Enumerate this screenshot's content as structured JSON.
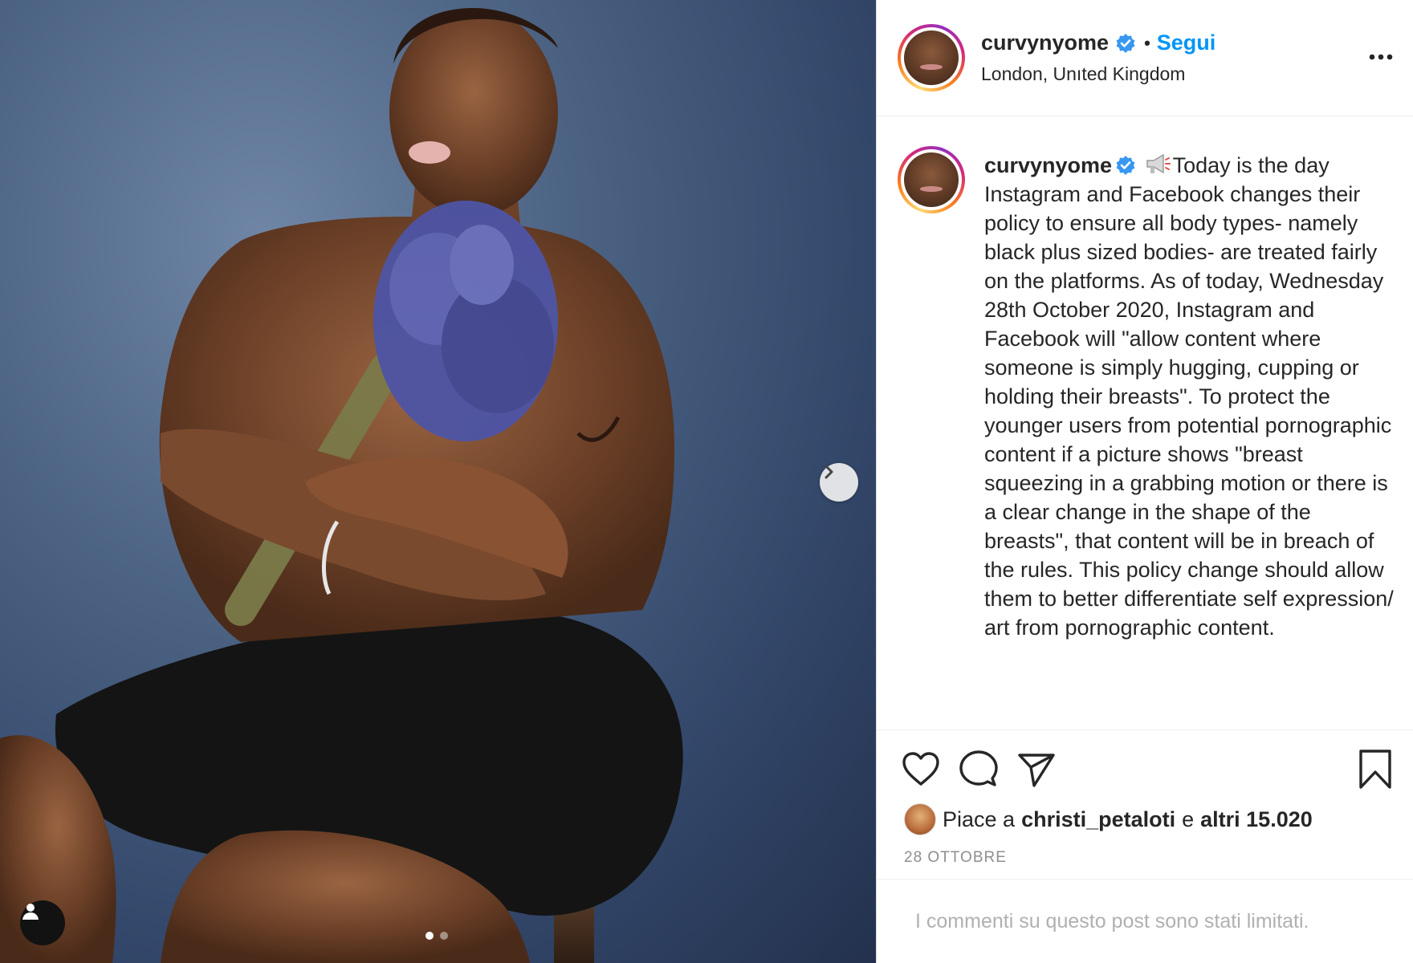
{
  "post": {
    "username": "curvynyome",
    "follow_label": "Segui",
    "separator": "•",
    "location": "London, Unıted Kingdom",
    "caption": "Today is the day Instagram and Facebook changes their policy to ensure all body types- namely black plus sized bodies- are treated fairly on the platforms. As of today, Wednesday 28th October 2020, Instagram and Facebook will \"allow content where someone is simply hugging, cupping or holding their breasts\". To protect the younger users from potential pornographic content if a picture shows \"breast squeezing in a grabbing motion or there is a clear change in the shape of the breasts\", that content will be in breach of the rules. This policy change should allow them to better differentiate self expression/ art from pornographic content.",
    "likes": {
      "prefix": "Piace a",
      "liker": "christi_petaloti",
      "joiner": "e",
      "others": "altri 15.020"
    },
    "date": "28 OTTOBRE",
    "comments_status": "I commenti su questo post sono stati limitati."
  },
  "carousel": {
    "slide_count": 2,
    "active_index": 0
  },
  "icons": {
    "verified": "verified-badge-icon",
    "more": "more-options-icon",
    "like": "heart-icon",
    "comment": "comment-bubble-icon",
    "share": "paper-plane-icon",
    "save": "bookmark-icon",
    "next": "chevron-right-icon",
    "tags": "person-tag-icon",
    "caption_emoji": "megaphone-icon"
  },
  "colors": {
    "link_blue": "#0095f6",
    "text": "#262626",
    "muted": "#8e8e8e",
    "verified_blue": "#3897f0"
  }
}
